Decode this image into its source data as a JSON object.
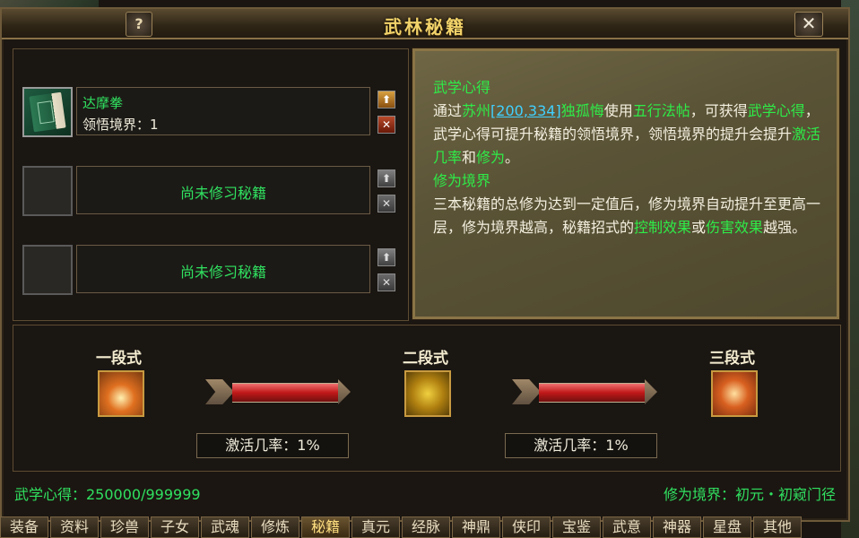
{
  "window": {
    "title": "武林秘籍",
    "help_label": "?",
    "close_label": "✕"
  },
  "slots": [
    {
      "name": "达摩拳",
      "level": "领悟境界：1",
      "up": "⬆",
      "remove": "✕"
    },
    {
      "empty_text": "尚未修习秘籍",
      "up": "⬆",
      "remove": "✕"
    },
    {
      "empty_text": "尚未修习秘籍",
      "up": "⬆",
      "remove": "✕"
    }
  ],
  "description": {
    "h1": "武学心得",
    "p1_a": "通过",
    "p1_city": "苏州",
    "p1_coord": "[200,334]",
    "p1_npc": "独孤悔",
    "p1_b": "使用",
    "p1_item": "五行法帖",
    "p1_c": "，可获得",
    "p1_xinde": "武学心得",
    "p1_d": "，武学心得可提升秘籍的领悟境界，领悟境界的提升会提升",
    "p1_rate": "激活几率",
    "p1_e": "和",
    "p1_xiuwei": "修为",
    "p1_f": "。",
    "h2": "修为境界",
    "p2_a": "三本秘籍的总修为达到一定值后，修为境界自动提升至更高一层，修为境界越高，秘籍招式的",
    "p2_ctrl": "控制效果",
    "p2_b": "或",
    "p2_dmg": "伤害效果",
    "p2_c": "越强。"
  },
  "stages": [
    {
      "label": "一段式",
      "icon": "flame-stage-icon"
    },
    {
      "label": "二段式",
      "icon": "swastika-stage-icon"
    },
    {
      "label": "三段式",
      "icon": "spider-stage-icon"
    }
  ],
  "rates": [
    {
      "text": "激活几率：1%"
    },
    {
      "text": "激活几率：1%"
    }
  ],
  "status": {
    "xinde": "武学心得：250000/999999",
    "realm": "修为境界：初元・初窥门径"
  },
  "tabs": [
    "装备",
    "资料",
    "珍兽",
    "子女",
    "武魂",
    "修炼",
    "秘籍",
    "真元",
    "经脉",
    "神鼎",
    "侠印",
    "宝鉴",
    "武意",
    "神器",
    "星盘",
    "其他"
  ],
  "active_tab": "秘籍",
  "colors": {
    "accent_green": "#30e060",
    "title_gold": "#f2d36a",
    "link_cyan": "#40d0ff"
  }
}
